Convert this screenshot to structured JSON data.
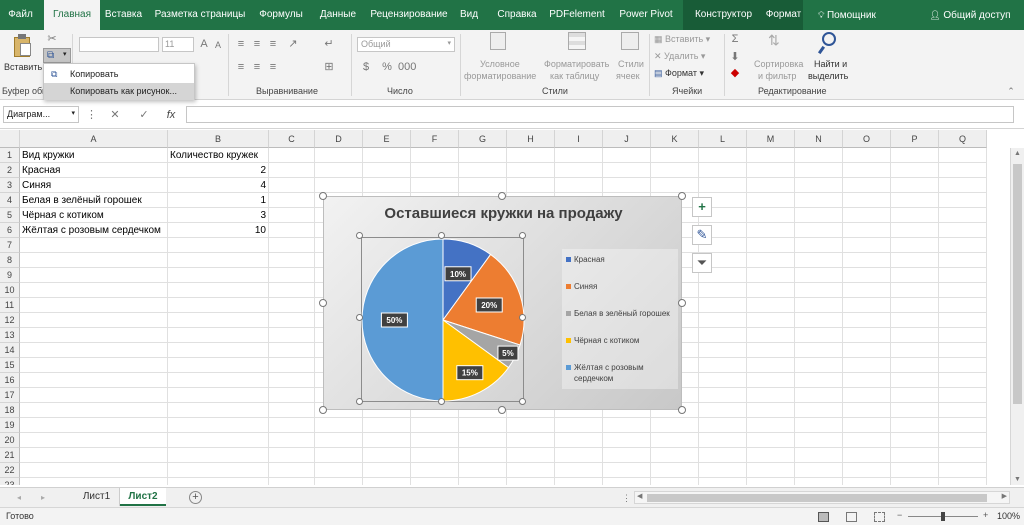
{
  "tabs": [
    {
      "label": "Файл",
      "state": "normal"
    },
    {
      "label": "Главная",
      "state": "active"
    },
    {
      "label": "Вставка",
      "state": "normal"
    },
    {
      "label": "Разметка страницы",
      "state": "normal"
    },
    {
      "label": "Формулы",
      "state": "normal"
    },
    {
      "label": "Данные",
      "state": "normal"
    },
    {
      "label": "Рецензирование",
      "state": "normal"
    },
    {
      "label": "Вид",
      "state": "normal"
    },
    {
      "label": "Справка",
      "state": "normal"
    },
    {
      "label": "PDFelement",
      "state": "normal"
    },
    {
      "label": "Power Pivot",
      "state": "normal"
    },
    {
      "label": "Конструктор",
      "state": "contextual"
    },
    {
      "label": "Формат",
      "state": "contextual"
    }
  ],
  "help_label": "Помощник",
  "share_label": "Общий доступ",
  "ribbon": {
    "paste_label": "Вставить",
    "clipboard_group": "Буфер обм",
    "font_size": "11",
    "alignment_group": "Выравнивание",
    "number_format": "Общий",
    "number_group": "Число",
    "cond_format": [
      "Условное",
      "форматирование"
    ],
    "table_format": [
      "Форматировать",
      "как таблицу"
    ],
    "cell_styles": [
      "Стили",
      "ячеек"
    ],
    "styles_group": "Стили",
    "insert_label": "Вставить",
    "delete_label": "Удалить",
    "format_label": "Формат",
    "cells_group": "Ячейки",
    "sort_filter": [
      "Сортировка",
      "и фильтр"
    ],
    "find_select": [
      "Найти и",
      "выделить"
    ],
    "editing_group": "Редактирование"
  },
  "copy_menu": {
    "items": [
      "Копировать",
      "Копировать как рисунок..."
    ]
  },
  "formula_bar": {
    "name_box": "Диаграм...",
    "fx": "fx",
    "value": ""
  },
  "grid": {
    "columns": [
      "A",
      "B",
      "C",
      "D",
      "E",
      "F",
      "G",
      "H",
      "I",
      "J",
      "K",
      "L",
      "M",
      "N",
      "O",
      "P",
      "Q"
    ],
    "rows": [
      "1",
      "2",
      "3",
      "4",
      "5",
      "6",
      "7",
      "8",
      "9",
      "10",
      "11",
      "12",
      "13",
      "14",
      "15",
      "16",
      "17",
      "18",
      "19",
      "20",
      "21",
      "22",
      "23"
    ],
    "header": [
      "Вид кружки",
      "Количество кружек"
    ],
    "data": [
      {
        "name": "Красная",
        "count": "2"
      },
      {
        "name": "Синяя",
        "count": "4"
      },
      {
        "name": "Белая в зелёный горошек",
        "count": "1"
      },
      {
        "name": "Чёрная с котиком",
        "count": "3"
      },
      {
        "name": "Жёлтая с розовым сердечком",
        "count": "10"
      }
    ]
  },
  "chart_data": {
    "type": "pie",
    "title": "Оставшиеся кружки на продажу",
    "categories": [
      "Красная",
      "Синяя",
      "Белая в зелёный горошек",
      "Чёрная с котиком",
      "Жёлтая с розовым сердечком"
    ],
    "values": [
      2,
      4,
      1,
      3,
      10
    ],
    "data_labels": [
      "10%",
      "20%",
      "5%",
      "15%",
      "50%"
    ],
    "colors": [
      "#4472c4",
      "#ed7d31",
      "#a5a5a5",
      "#ffc000",
      "#5b9bd5"
    ],
    "legend_position": "right"
  },
  "sheets": [
    {
      "name": "Лист1",
      "active": false
    },
    {
      "name": "Лист2",
      "active": true
    }
  ],
  "status": {
    "ready": "Готово",
    "zoom": "100%"
  }
}
